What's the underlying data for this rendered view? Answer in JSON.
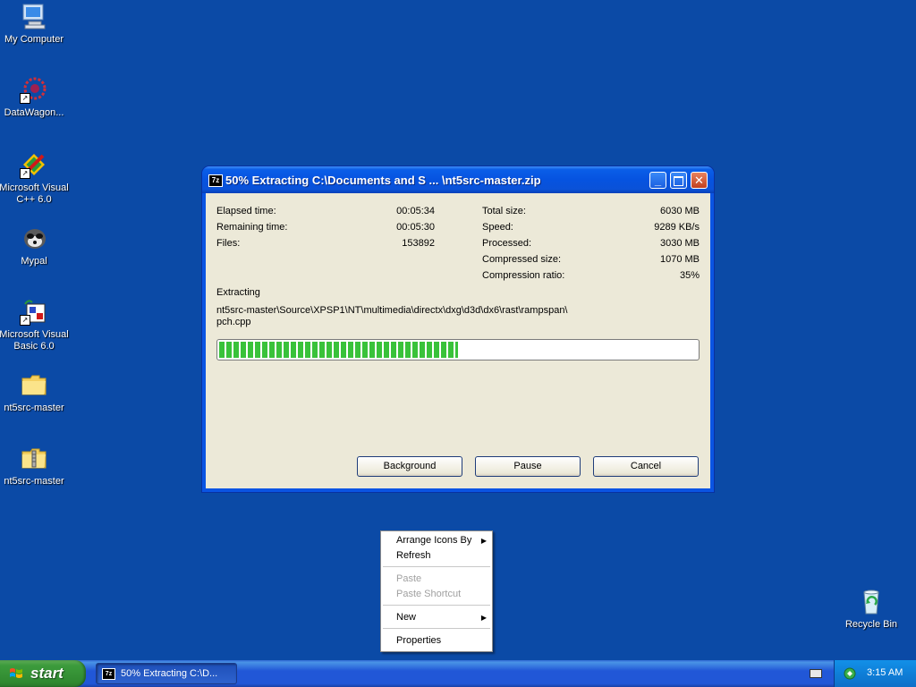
{
  "desktop": {
    "icons": [
      {
        "label": "My Computer",
        "icon": "my-computer-icon"
      },
      {
        "label": "DataWagon...",
        "icon": "datawagon-icon"
      },
      {
        "label": "Microsoft Visual C++ 6.0",
        "icon": "visual-cpp-icon"
      },
      {
        "label": "Mypal",
        "icon": "mypal-icon"
      },
      {
        "label": "Microsoft Visual Basic 6.0",
        "icon": "visual-basic-icon"
      },
      {
        "label": "nt5src-master",
        "icon": "folder-icon"
      },
      {
        "label": "nt5src-master",
        "icon": "zip-folder-icon"
      },
      {
        "label": "Recycle Bin",
        "icon": "recycle-bin-icon"
      }
    ],
    "background_color": "#0b4aa6"
  },
  "window": {
    "app_icon_text": "7z",
    "title": "50% Extracting C:\\Documents and S ... \\nt5src-master.zip",
    "left_stats": [
      {
        "label": "Elapsed time:",
        "value": "00:05:34"
      },
      {
        "label": "Remaining time:",
        "value": "00:05:30"
      },
      {
        "label": "Files:",
        "value": "153892"
      }
    ],
    "right_stats": [
      {
        "label": "Total size:",
        "value": "6030 MB"
      },
      {
        "label": "Speed:",
        "value": "9289 KB/s"
      },
      {
        "label": "Processed:",
        "value": "3030 MB"
      },
      {
        "label": "Compressed size:",
        "value": "1070 MB"
      },
      {
        "label": "Compression ratio:",
        "value": "35%"
      }
    ],
    "extracting_label": "Extracting",
    "current_file_line1": "nt5src-master\\Source\\XPSP1\\NT\\multimedia\\directx\\dxg\\d3d\\dx6\\rast\\rampspan\\",
    "current_file_line2": "pch.cpp",
    "progress_fraction": 0.5,
    "buttons": {
      "background": "Background",
      "pause": "Pause",
      "cancel": "Cancel"
    }
  },
  "context_menu": {
    "arrange": "Arrange Icons By",
    "refresh": "Refresh",
    "paste": "Paste",
    "paste_shortcut": "Paste Shortcut",
    "new": "New",
    "properties": "Properties"
  },
  "taskbar": {
    "start_label": "start",
    "task_icon_text": "7z",
    "task_label": "50% Extracting C:\\D...",
    "clock": "3:15 AM"
  }
}
